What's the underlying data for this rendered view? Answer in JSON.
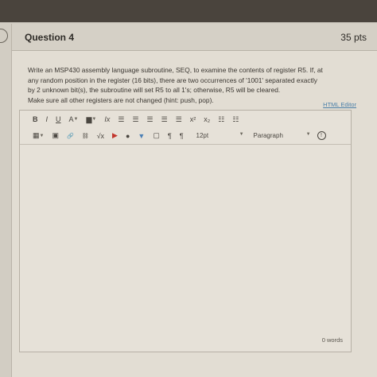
{
  "question": {
    "title": "Question 4",
    "points": "35 pts",
    "lines": [
      "Write an MSP430 assembly language subroutine, SEQ, to examine the contents of register R5. If, at",
      "any random position in the register (16 bits), there are two occurrences of '1001' separated exactly",
      "by 2 unknown bit(s), the subroutine will set R5 to all 1's; otherwise, R5 will be cleared.",
      "Make sure all other registers are not changed (hint: push, pop)."
    ]
  },
  "editor": {
    "html_editor_link": "HTML Editor",
    "toolbar_row1": {
      "bold": "B",
      "italic": "I",
      "underline": "U",
      "font_color": "A",
      "background_color": "▆",
      "clear_format": "Ix",
      "align_left": "☰",
      "align_center": "☰",
      "align_right": "☰",
      "align_justify": "☰",
      "indent": "☰",
      "superscript": "x²",
      "subscript": "x₂",
      "bullet_list": "☷",
      "numbered_list": "☷"
    },
    "toolbar_row2": {
      "table": "▦",
      "image": "▣",
      "link": "🔗",
      "unlink": "⛓",
      "math": "√x",
      "youtube": "▶",
      "record": "●",
      "dropdown": "▼",
      "embed": "▢",
      "ltr": "¶",
      "rtl": "¶",
      "font_size": "12pt",
      "paragraph": "Paragraph",
      "accessibility": "⓪"
    },
    "word_count": "0 words"
  }
}
